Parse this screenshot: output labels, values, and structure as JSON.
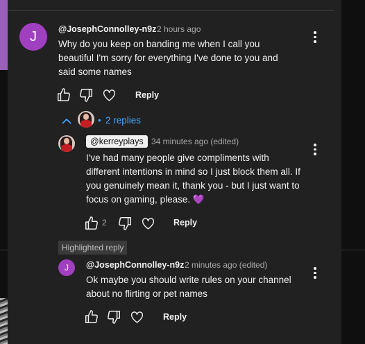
{
  "top_comment": {
    "avatar_letter": "J",
    "author": "@JosephConnolley-n9z",
    "time": "2 hours ago",
    "text": "Why do you keep on banding me when I call you beautiful I'm sorry for everything I've done to you and said some names",
    "reply_label": "Reply"
  },
  "replies_toggle": {
    "dot": "•",
    "label": "2 replies"
  },
  "reply1": {
    "author": "@kerreyplays",
    "time": "34 minutes ago (edited)",
    "text": "I've had many people give compliments with different intentions in mind so I just block them all. If you genuinely mean it, thank you - but I just want to focus on gaming, please.",
    "emoji": "💜",
    "like_count": "2",
    "reply_label": "Reply"
  },
  "highlighted_label": "Highlighted reply",
  "reply2": {
    "avatar_letter": "J",
    "author": "@JosephConnolley-n9z",
    "time": "2 minutes ago (edited)",
    "text": "Ok maybe you should write rules on your channel about no flirting or pet names",
    "reply_label": "Reply"
  },
  "colors": {
    "accent_link": "#3ea6ff",
    "avatar_purple": "#a13fc1",
    "panel_bg": "#212121"
  }
}
